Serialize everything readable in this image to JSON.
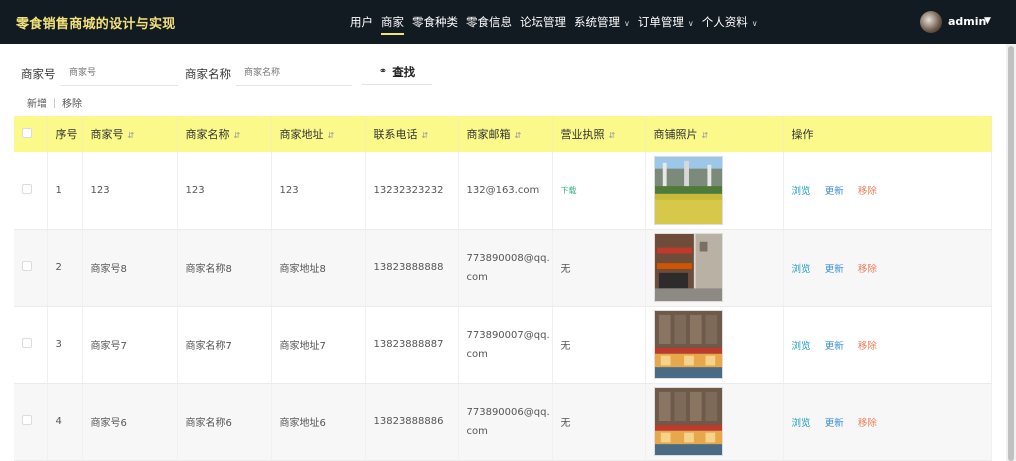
{
  "header": {
    "brand": "零食销售商城的设计与实现",
    "nav": [
      {
        "label": "用户",
        "dropdown": false,
        "active": false
      },
      {
        "label": "商家",
        "dropdown": false,
        "active": true
      },
      {
        "label": "零食种类",
        "dropdown": false,
        "active": false
      },
      {
        "label": "零食信息",
        "dropdown": false,
        "active": false
      },
      {
        "label": "论坛管理",
        "dropdown": false,
        "active": false
      },
      {
        "label": "系统管理",
        "dropdown": true,
        "active": false
      },
      {
        "label": "订单管理",
        "dropdown": true,
        "active": false
      },
      {
        "label": "个人资料",
        "dropdown": true,
        "active": false
      }
    ],
    "user": "admin",
    "brand_color": "#f3e27a"
  },
  "search": {
    "merchant_no_label": "商家号",
    "merchant_no_placeholder": "商家号",
    "merchant_name_label": "商家名称",
    "merchant_name_placeholder": "商家名称",
    "search_button": "查找"
  },
  "actions": {
    "add": "新增",
    "remove": "移除"
  },
  "table": {
    "header_color": "#faf98a",
    "columns": [
      "序号",
      "商家号",
      "商家名称",
      "商家地址",
      "联系电话",
      "商家邮箱",
      "营业执照",
      "商铺照片",
      "操作"
    ],
    "rows": [
      {
        "seq": "1",
        "no": "123",
        "name": "123",
        "address": "123",
        "phone": "13232323232",
        "email": "132@163.com",
        "license": "下载",
        "license_link": true,
        "photo": "field"
      },
      {
        "seq": "2",
        "no": "商家号8",
        "name": "商家名称8",
        "address": "商家地址8",
        "phone": "13823888888",
        "email": "773890008@qq.com",
        "license": "无",
        "license_link": false,
        "photo": "street"
      },
      {
        "seq": "3",
        "no": "商家号7",
        "name": "商家名称7",
        "address": "商家地址7",
        "phone": "13823888887",
        "email": "773890007@qq.com",
        "license": "无",
        "license_link": false,
        "photo": "mall"
      },
      {
        "seq": "4",
        "no": "商家号6",
        "name": "商家名称6",
        "address": "商家地址6",
        "phone": "13823888886",
        "email": "773890006@qq.com",
        "license": "无",
        "license_link": false,
        "photo": "mall"
      }
    ],
    "ops": {
      "view": "浏览",
      "update": "更新",
      "remove": "移除"
    }
  }
}
